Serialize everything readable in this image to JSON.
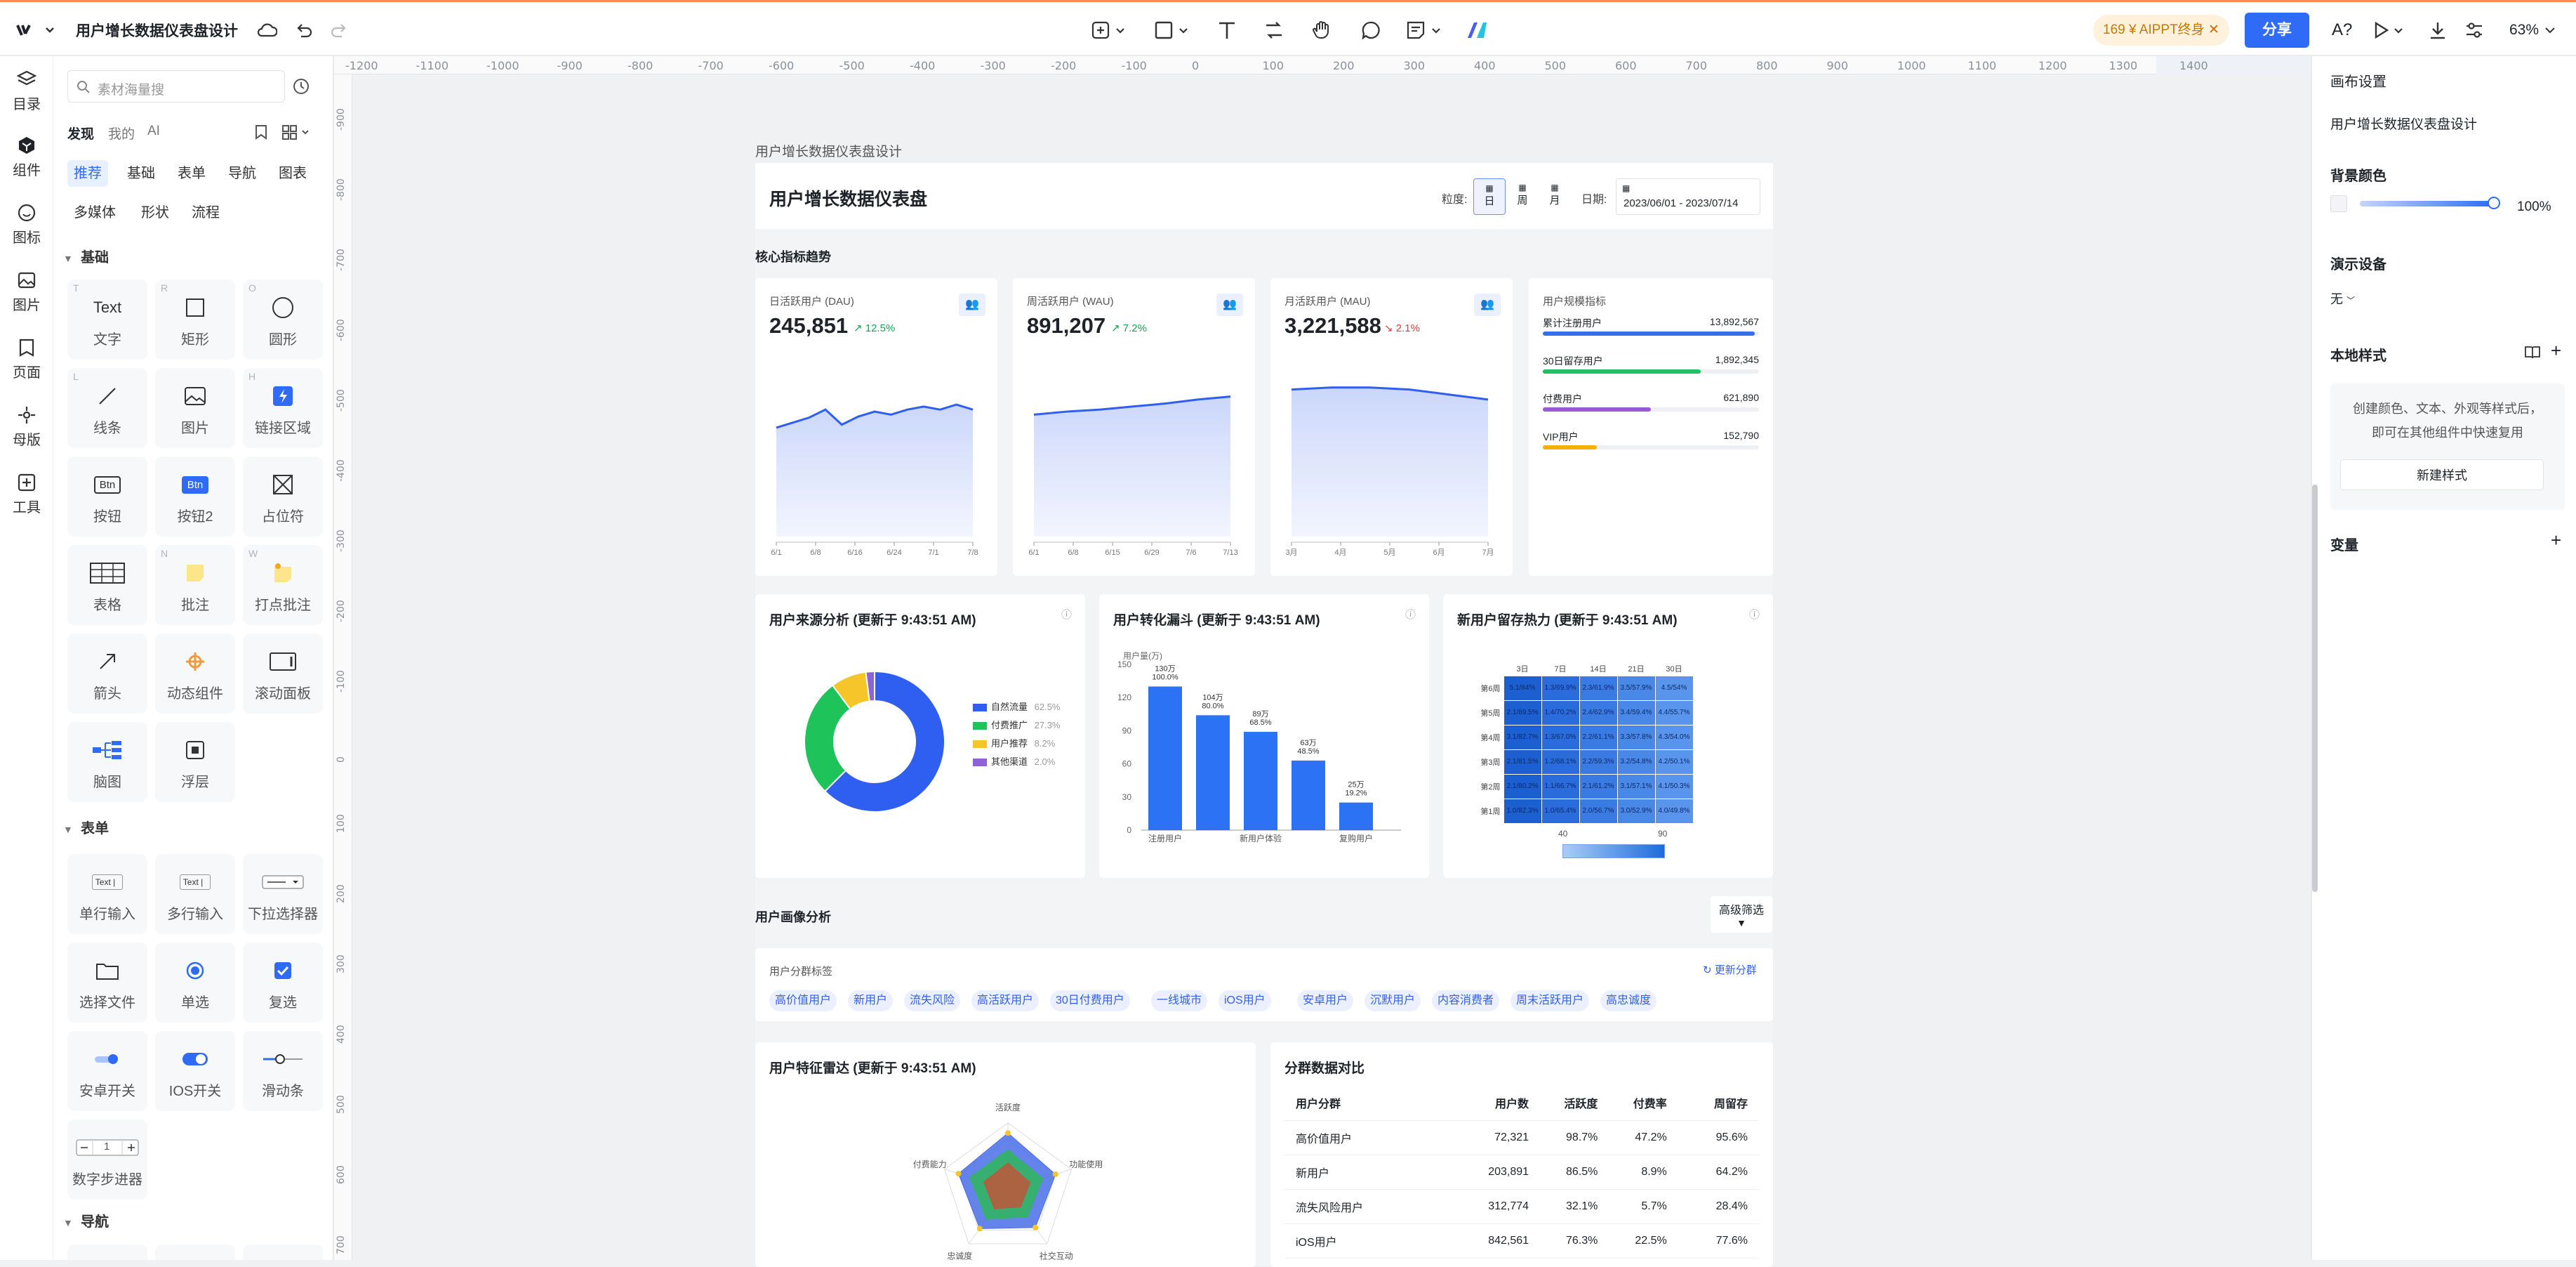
{
  "topbar": {
    "doc_title": "用户增长数据仪表盘设计",
    "promo": "169 ¥ AIPPT终身",
    "share": "分享",
    "zoom": "63%"
  },
  "rail": [
    {
      "label": "目录",
      "icon": "layers-icon"
    },
    {
      "label": "组件",
      "icon": "component-icon"
    },
    {
      "label": "图标",
      "icon": "emoji-icon"
    },
    {
      "label": "图片",
      "icon": "image-icon"
    },
    {
      "label": "页面",
      "icon": "page-icon"
    },
    {
      "label": "母版",
      "icon": "master-icon"
    },
    {
      "label": "工具",
      "icon": "tool-icon"
    }
  ],
  "panel": {
    "search_placeholder": "素材海量搜",
    "tabs": [
      "发现",
      "我的",
      "AI"
    ],
    "cats": [
      "推荐",
      "基础",
      "表单",
      "导航",
      "图表",
      "多媒体",
      "形状",
      "流程"
    ],
    "sec_basic": "基础",
    "sec_form": "表单",
    "sec_nav": "导航",
    "basic": [
      {
        "label": "文字",
        "sc": "T"
      },
      {
        "label": "矩形",
        "sc": "R"
      },
      {
        "label": "圆形",
        "sc": "O"
      },
      {
        "label": "线条",
        "sc": "L"
      },
      {
        "label": "图片",
        "sc": ""
      },
      {
        "label": "链接区域",
        "sc": "H"
      },
      {
        "label": "按钮",
        "sc": ""
      },
      {
        "label": "按钮2",
        "sc": ""
      },
      {
        "label": "占位符",
        "sc": ""
      },
      {
        "label": "表格",
        "sc": ""
      },
      {
        "label": "批注",
        "sc": "N"
      },
      {
        "label": "打点批注",
        "sc": "W"
      },
      {
        "label": "箭头",
        "sc": ""
      },
      {
        "label": "动态组件",
        "sc": ""
      },
      {
        "label": "滚动面板",
        "sc": ""
      },
      {
        "label": "脑图",
        "sc": ""
      },
      {
        "label": "浮层",
        "sc": ""
      }
    ],
    "form": [
      {
        "label": "单行输入"
      },
      {
        "label": "多行输入"
      },
      {
        "label": "下拉选择器"
      },
      {
        "label": "选择文件"
      },
      {
        "label": "单选"
      },
      {
        "label": "复选"
      },
      {
        "label": "安卓开关"
      },
      {
        "label": "IOS开关"
      },
      {
        "label": "滑动条"
      },
      {
        "label": "数字步进器"
      }
    ],
    "glyph_text": "Text",
    "glyph_btn": "Btn",
    "glyph_input": "Text |",
    "stepper_val": "1"
  },
  "ruler_x": [
    "-1200",
    "-1100",
    "-1000",
    "-900",
    "-800",
    "-700",
    "-600",
    "-500",
    "-400",
    "-300",
    "-200",
    "-100",
    "0",
    "100",
    "200",
    "300",
    "400",
    "500",
    "600",
    "700",
    "800",
    "900",
    "1000",
    "1100",
    "1200",
    "1300",
    "1400"
  ],
  "ruler_y": [
    "-900",
    "-800",
    "-700",
    "-600",
    "-500",
    "-400",
    "-300",
    "-200",
    "-100",
    "0",
    "100",
    "200",
    "300",
    "400",
    "500",
    "600",
    "700"
  ],
  "right": {
    "canvas_settings": "画布设置",
    "name": "用户增长数据仪表盘设计",
    "bg_color": "背景颜色",
    "opacity": "100%",
    "device": "演示设备",
    "device_val": "无",
    "local_style": "本地样式",
    "style_hint1": "创建颜色、文本、外观等样式后，",
    "style_hint2": "即可在其他组件中快速复用",
    "new_style": "新建样式",
    "variables": "变量"
  },
  "frame_label": "用户增长数据仪表盘设计",
  "dash": {
    "title": "用户增长数据仪表盘",
    "granularity": "粒度:",
    "gran_opts": [
      "日",
      "周",
      "月"
    ],
    "date_label": "日期:",
    "date_range": "2023/06/01 - 2023/07/14",
    "sec_core": "核心指标趋势",
    "metrics": [
      {
        "label": "日活跃用户 (DAU)",
        "value": "245,851",
        "change": "12.5%",
        "up": true,
        "ticks": [
          "6/1",
          "6/8",
          "6/16",
          "6/24",
          "7/1",
          "7/8"
        ]
      },
      {
        "label": "周活跃用户 (WAU)",
        "value": "891,207",
        "change": "7.2%",
        "up": true,
        "ticks": [
          "6/1",
          "6/8",
          "6/15",
          "6/29",
          "7/6",
          "7/13"
        ]
      },
      {
        "label": "月活跃用户 (MAU)",
        "value": "3,221,588",
        "change": "2.1%",
        "up": false,
        "ticks": [
          "3月",
          "4月",
          "5月",
          "6月",
          "7月"
        ]
      }
    ],
    "scale": {
      "title": "用户规模指标",
      "rows": [
        {
          "label": "累计注册用户",
          "value": "13,892,567",
          "pct": 0.98,
          "color": "#3b6cf0"
        },
        {
          "label": "30日留存用户",
          "value": "1,892,345",
          "pct": 0.73,
          "color": "#20c060"
        },
        {
          "label": "付费用户",
          "value": "621,890",
          "pct": 0.5,
          "color": "#9a5ad8"
        },
        {
          "label": "VIP用户",
          "value": "152,790",
          "pct": 0.25,
          "color": "#f0b400"
        }
      ]
    },
    "source": {
      "title": "用户来源分析 (更新于 9:43:51 AM)"
    },
    "funnel": {
      "title": "用户转化漏斗 (更新于 9:43:51 AM)",
      "ylabel": "用户量(万)"
    },
    "retention": {
      "title": "新用户留存热力 (更新于 9:43:51 AM)",
      "cols": [
        "3日",
        "7日",
        "14日",
        "21日",
        "30日"
      ],
      "rows": [
        "第6周",
        "第5周",
        "第4周",
        "第3周",
        "第2周",
        "第1周"
      ],
      "cells": [
        [
          "5.1/84%",
          "1.3/69.9%",
          "2.3/61.9%",
          "3.5/57.9%",
          "4.5/54%"
        ],
        [
          "2.1/89.5%",
          "1.4/70.2%",
          "2.4/62.9%",
          "3.4/59.4%",
          "4.4/55.7%"
        ],
        [
          "3.1/82.7%",
          "1.3/67.0%",
          "2.2/61.1%",
          "3.3/57.8%",
          "4.3/54.0%"
        ],
        [
          "2.1/81.5%",
          "1.2/68.1%",
          "2.2/59.3%",
          "3.2/54.8%",
          "4.2/50.1%"
        ],
        [
          "2.1/80.2%",
          "1.1/66.7%",
          "2.1/61.2%",
          "3.1/57.1%",
          "4.1/50.3%"
        ],
        [
          "1.0/82.3%",
          "1.0/65.4%",
          "2.0/56.7%",
          "3.0/52.9%",
          "4.0/49.8%"
        ]
      ],
      "scale_min": "40",
      "scale_max": "90"
    },
    "sec_portrait": "用户画像分析",
    "filter_btn": "高级筛选",
    "tags": {
      "title": "用户分群标签",
      "refresh": "更新分群",
      "items": [
        "高价值用户",
        "新用户",
        "流失风险",
        "高活跃用户",
        "30日付费用户",
        "一线城市",
        "iOS用户",
        "安卓用户",
        "沉默用户",
        "内容消费者",
        "周末活跃用户",
        "高忠诚度"
      ]
    },
    "radar": {
      "title": "用户特征雷达 (更新于 9:43:51 AM)",
      "axes": [
        "活跃度",
        "功能使用",
        "社交互动",
        "忠诚度",
        "付费能力"
      ]
    },
    "compare": {
      "title": "分群数据对比",
      "headers": [
        "用户分群",
        "用户数",
        "活跃度",
        "付费率",
        "周留存"
      ],
      "rows": [
        [
          "高价值用户",
          "72,321",
          "98.7%",
          "47.2%",
          "95.6%"
        ],
        [
          "新用户",
          "203,891",
          "86.5%",
          "8.9%",
          "64.2%"
        ],
        [
          "流失风险用户",
          "312,774",
          "32.1%",
          "5.7%",
          "28.4%"
        ],
        [
          "iOS用户",
          "842,561",
          "76.3%",
          "22.5%",
          "77.6%"
        ]
      ]
    }
  },
  "chart_data": [
    {
      "type": "pie",
      "title": "用户来源分析 (更新于 9:43:51 AM)",
      "categories": [
        "自然流量",
        "付费推广",
        "用户推荐",
        "其他渠道"
      ],
      "values": [
        62.5,
        27.3,
        8.2,
        2.0
      ],
      "colors": [
        "#2f5ff0",
        "#1ec45a",
        "#f5c52a",
        "#8f63d6"
      ],
      "labels": [
        "62.5%",
        "27.3%",
        "8.2%",
        "2.0%"
      ]
    },
    {
      "type": "bar",
      "title": "用户转化漏斗 (更新于 9:43:51 AM)",
      "categories": [
        "注册用户",
        "",
        "新用户体验",
        "",
        "复购用户"
      ],
      "values": [
        130,
        104,
        89,
        63,
        25
      ],
      "labels": [
        "130万 100.0%",
        "104万 80.0%",
        "89万 68.5%",
        "63万 48.5%",
        "25万 19.2%"
      ],
      "ylim": [
        0,
        150
      ],
      "yticks": [
        0,
        30,
        60,
        90,
        120,
        150
      ],
      "ylabel": "用户量(万)"
    },
    {
      "type": "line",
      "title": "日活跃用户 (DAU)",
      "values": [
        0.42,
        0.47,
        0.52,
        0.6,
        0.45,
        0.53,
        0.58,
        0.55,
        0.6,
        0.63,
        0.6,
        0.65,
        0.6
      ]
    },
    {
      "type": "line",
      "title": "周活跃用户 (WAU)",
      "values": [
        0.55,
        0.58,
        0.6,
        0.63,
        0.66,
        0.7,
        0.73
      ]
    },
    {
      "type": "line",
      "title": "月活跃用户 (MAU)",
      "values": [
        0.8,
        0.82,
        0.82,
        0.8,
        0.75,
        0.7
      ]
    },
    {
      "type": "radar",
      "title": "用户特征雷达 (更新于 9:43:51 AM)",
      "axes": [
        "活跃度",
        "功能使用",
        "社交互动",
        "忠诚度",
        "付费能力"
      ],
      "series": [
        {
          "values": [
            0.85,
            0.75,
            0.7,
            0.72,
            0.78
          ]
        },
        {
          "values": [
            0.6,
            0.55,
            0.5,
            0.55,
            0.6
          ]
        },
        {
          "values": [
            0.4,
            0.35,
            0.32,
            0.35,
            0.38
          ]
        }
      ]
    }
  ]
}
